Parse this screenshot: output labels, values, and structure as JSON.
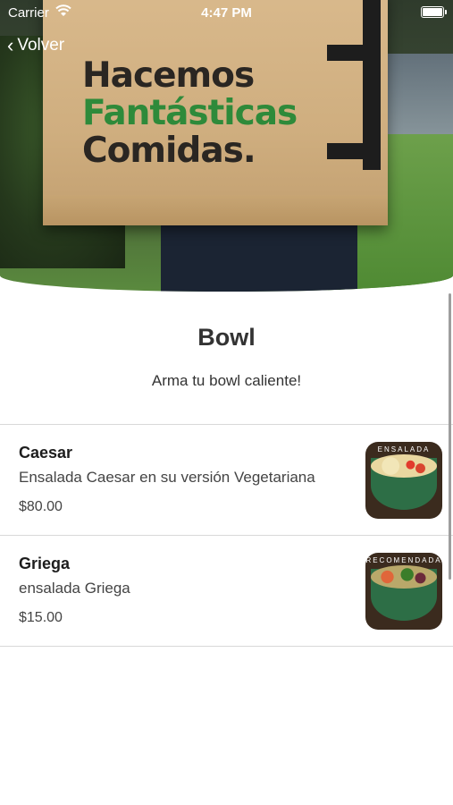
{
  "status_bar": {
    "carrier": "Carrier",
    "time": "4:47 PM"
  },
  "nav": {
    "back_label": "Volver"
  },
  "hero": {
    "bag_text": [
      "Hacemos",
      "Fantásticas",
      "Comidas."
    ]
  },
  "category": {
    "title": "Bowl",
    "subtitle": "Arma tu bowl caliente!"
  },
  "items": [
    {
      "name": "Caesar",
      "description": "Ensalada Caesar en su versión Vegetariana",
      "price": "$80.00",
      "label": "ENSALADA"
    },
    {
      "name": "Griega",
      "description": "ensalada Griega",
      "price": "$15.00",
      "label": "RECOMENDADA"
    }
  ],
  "colors": {
    "accent_green": "#2e8a3a",
    "divider": "#d8d8d8"
  }
}
